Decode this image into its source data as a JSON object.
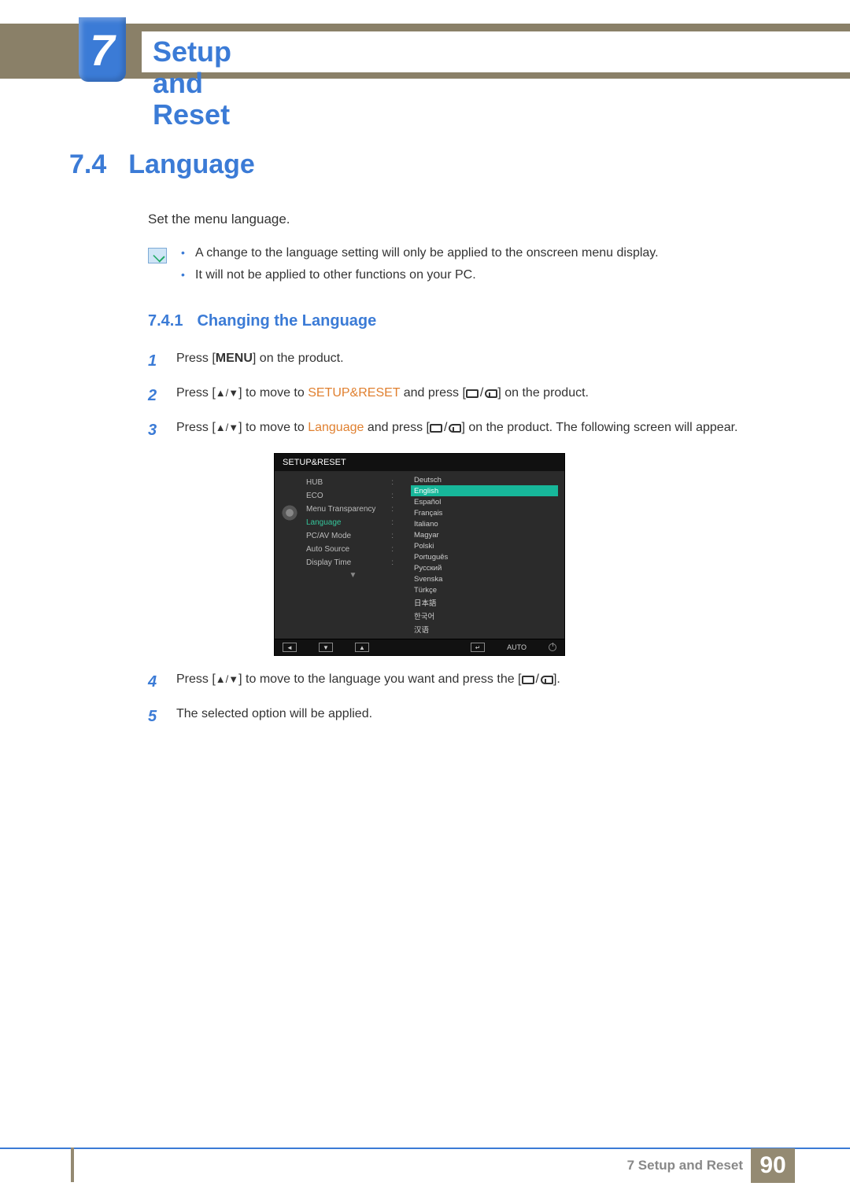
{
  "chapter": {
    "number": "7",
    "title": "Setup and Reset"
  },
  "section": {
    "number": "7.4",
    "title": "Language",
    "intro": "Set the menu language."
  },
  "notes": [
    "A change to the language setting will only be applied to the onscreen menu display.",
    "It will not be applied to other functions on your PC."
  ],
  "subsection": {
    "number": "7.4.1",
    "title": "Changing the Language"
  },
  "steps": {
    "s1": {
      "num": "1",
      "a": "Press [",
      "menu": "MENU",
      "b": "] on the product."
    },
    "s2": {
      "num": "2",
      "a": "Press [",
      "arrows": "▲/▼",
      "b": "] to move to ",
      "target": "SETUP&RESET",
      "c": " and press [",
      "d": "] on the product."
    },
    "s3": {
      "num": "3",
      "a": "Press [",
      "arrows": "▲/▼",
      "b": "] to move to ",
      "target": "Language",
      "c": " and press [",
      "d": "] on the product. The following screen will appear."
    },
    "s4": {
      "num": "4",
      "a": "Press [",
      "arrows": "▲/▼",
      "b": "] to move to the language you want and press the [",
      "c": "]."
    },
    "s5": {
      "num": "5",
      "text": "The selected option will be applied."
    }
  },
  "osd": {
    "title": "SETUP&RESET",
    "left": [
      "HUB",
      "ECO",
      "Menu Transparency",
      "Language",
      "PC/AV Mode",
      "Auto Source",
      "Display Time"
    ],
    "left_active_index": 3,
    "right": [
      "Deutsch",
      "English",
      "Español",
      "Français",
      "Italiano",
      "Magyar",
      "Polski",
      "Português",
      "Русский",
      "Svenska",
      "Türkçe",
      "日本語",
      "한국어",
      "汉语"
    ],
    "right_selected_index": 1,
    "footer_auto": "AUTO"
  },
  "footer": {
    "label": "7 Setup and Reset",
    "page": "90"
  }
}
